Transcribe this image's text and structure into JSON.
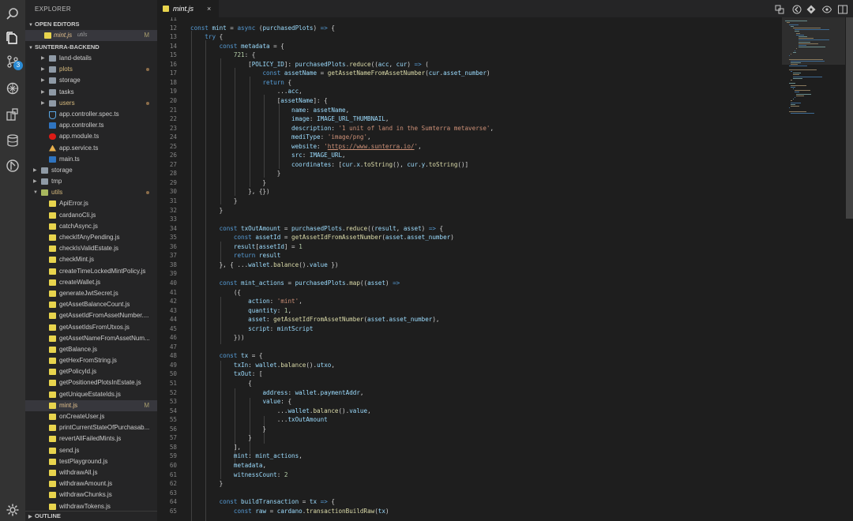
{
  "sidebar": {
    "title": "EXPLORER",
    "open_editors_header": "OPEN EDITORS",
    "open_editor": {
      "name": "mint.js",
      "dir": "utils",
      "status": "M"
    },
    "project_header": "SUNTERRA-BACKEND",
    "outline_header": "OUTLINE",
    "tree": [
      {
        "label": "land-details",
        "type": "folder",
        "depth": 2,
        "expanded": false
      },
      {
        "label": "plots",
        "type": "folder",
        "depth": 2,
        "expanded": false,
        "dot": true
      },
      {
        "label": "storage",
        "type": "folder",
        "depth": 2,
        "expanded": false
      },
      {
        "label": "tasks",
        "type": "folder",
        "depth": 2,
        "expanded": false
      },
      {
        "label": "users",
        "type": "folder",
        "depth": 2,
        "expanded": false,
        "dot": true
      },
      {
        "label": "app.controller.spec.ts",
        "type": "spec",
        "depth": 2
      },
      {
        "label": "app.controller.ts",
        "type": "ts",
        "depth": 2
      },
      {
        "label": "app.module.ts",
        "type": "module",
        "depth": 2
      },
      {
        "label": "app.service.ts",
        "type": "service",
        "depth": 2
      },
      {
        "label": "main.ts",
        "type": "ts",
        "depth": 2
      },
      {
        "label": "storage",
        "type": "folder",
        "depth": 1,
        "expanded": false
      },
      {
        "label": "tmp",
        "type": "folder",
        "depth": 1,
        "expanded": false
      },
      {
        "label": "utils",
        "type": "folder-open",
        "depth": 1,
        "expanded": true,
        "dot": true
      },
      {
        "label": "ApiError.js",
        "type": "js",
        "depth": 2
      },
      {
        "label": "cardanoCli.js",
        "type": "js",
        "depth": 2
      },
      {
        "label": "catchAsync.js",
        "type": "js",
        "depth": 2
      },
      {
        "label": "checkIfAnyPending.js",
        "type": "js",
        "depth": 2
      },
      {
        "label": "checkIsValidEstate.js",
        "type": "js",
        "depth": 2
      },
      {
        "label": "checkMint.js",
        "type": "js",
        "depth": 2
      },
      {
        "label": "createTimeLockedMintPolicy.js",
        "type": "js",
        "depth": 2
      },
      {
        "label": "createWallet.js",
        "type": "js",
        "depth": 2
      },
      {
        "label": "generateJwtSecret.js",
        "type": "js",
        "depth": 2
      },
      {
        "label": "getAssetBalanceCount.js",
        "type": "js",
        "depth": 2
      },
      {
        "label": "getAssetIdFromAssetNumber....",
        "type": "js",
        "depth": 2
      },
      {
        "label": "getAssetIdsFromUtxos.js",
        "type": "js",
        "depth": 2
      },
      {
        "label": "getAssetNameFromAssetNum...",
        "type": "js",
        "depth": 2
      },
      {
        "label": "getBalance.js",
        "type": "js",
        "depth": 2
      },
      {
        "label": "getHexFromString.js",
        "type": "js",
        "depth": 2
      },
      {
        "label": "getPolicyId.js",
        "type": "js",
        "depth": 2
      },
      {
        "label": "getPositionedPlotsInEstate.js",
        "type": "js",
        "depth": 2
      },
      {
        "label": "getUniqueEstateIds.js",
        "type": "js",
        "depth": 2
      },
      {
        "label": "mint.js",
        "type": "js",
        "depth": 2,
        "active": true,
        "status": "M"
      },
      {
        "label": "onCreateUser.js",
        "type": "js",
        "depth": 2
      },
      {
        "label": "printCurrentStateOfPurchasab...",
        "type": "js",
        "depth": 2
      },
      {
        "label": "revertAllFailedMints.js",
        "type": "js",
        "depth": 2
      },
      {
        "label": "send.js",
        "type": "js",
        "depth": 2
      },
      {
        "label": "testPlayground.js",
        "type": "js",
        "depth": 2
      },
      {
        "label": "withdrawAll.js",
        "type": "js",
        "depth": 2
      },
      {
        "label": "withdrawAmount.js",
        "type": "js",
        "depth": 2
      },
      {
        "label": "withdrawChunks.js",
        "type": "js",
        "depth": 2
      },
      {
        "label": "withdrawTokens.js",
        "type": "js",
        "depth": 2
      }
    ]
  },
  "activity": {
    "scm_badge": "3"
  },
  "tab": {
    "name": "mint.js",
    "close": "×"
  },
  "editor": {
    "lines": [
      {
        "n": "11",
        "t": ""
      },
      {
        "n": "12",
        "t": "const mint = async (purchasedPlots) => {"
      },
      {
        "n": "13",
        "t": "    try {"
      },
      {
        "n": "14",
        "t": "        const metadata = {"
      },
      {
        "n": "15",
        "t": "            721: {"
      },
      {
        "n": "16",
        "t": "                [POLICY_ID]: purchasedPlots.reduce((acc, cur) => ("
      },
      {
        "n": "17",
        "t": "                    const assetName = getAssetNameFromAssetNumber(cur.asset_number)"
      },
      {
        "n": "18",
        "t": "                    return {"
      },
      {
        "n": "19",
        "t": "                        ...acc,"
      },
      {
        "n": "20",
        "t": "                        [assetName]: {"
      },
      {
        "n": "21",
        "t": "                            name: assetName,"
      },
      {
        "n": "22",
        "t": "                            image: IMAGE_URL_THUMBNAIL,"
      },
      {
        "n": "23",
        "t": "                            description: '1 unit of land in the Sumterra metaverse',"
      },
      {
        "n": "24",
        "t": "                            mediType: 'image/png',"
      },
      {
        "n": "25",
        "t": "                            website: 'https://www.sunterra.io/',"
      },
      {
        "n": "26",
        "t": "                            src: IMAGE_URL,"
      },
      {
        "n": "27",
        "t": "                            coordinates: [cur.x.toString(), cur.y.toString()]"
      },
      {
        "n": "28",
        "t": "                        }"
      },
      {
        "n": "29",
        "t": "                    }"
      },
      {
        "n": "30",
        "t": "                }, {})"
      },
      {
        "n": "31",
        "t": "            }"
      },
      {
        "n": "32",
        "t": "        }"
      },
      {
        "n": "33",
        "t": ""
      },
      {
        "n": "34",
        "t": "        const txOutAmount = purchasedPlots.reduce((result, asset) => {"
      },
      {
        "n": "35",
        "t": "            const assetId = getAssetIdFromAssetNumber(asset.asset_number)"
      },
      {
        "n": "36",
        "t": "            result[assetId] = 1"
      },
      {
        "n": "37",
        "t": "            return result"
      },
      {
        "n": "38",
        "t": "        }, { ...wallet.balance().value })"
      },
      {
        "n": "39",
        "t": ""
      },
      {
        "n": "40",
        "t": "        const mint_actions = purchasedPlots.map((asset) =>"
      },
      {
        "n": "41",
        "t": "            ({"
      },
      {
        "n": "42",
        "t": "                action: 'mint',"
      },
      {
        "n": "43",
        "t": "                quantity: 1,"
      },
      {
        "n": "44",
        "t": "                asset: getAssetIdFromAssetNumber(asset.asset_number),"
      },
      {
        "n": "45",
        "t": "                script: mintScript"
      },
      {
        "n": "46",
        "t": "            }))"
      },
      {
        "n": "47",
        "t": ""
      },
      {
        "n": "48",
        "t": "        const tx = {"
      },
      {
        "n": "49",
        "t": "            txIn: wallet.balance().utxo,"
      },
      {
        "n": "50",
        "t": "            txOut: ["
      },
      {
        "n": "51",
        "t": "                {"
      },
      {
        "n": "52",
        "t": "                    address: wallet.paymentAddr,"
      },
      {
        "n": "53",
        "t": "                    value: {"
      },
      {
        "n": "54",
        "t": "                        ...wallet.balance().value,"
      },
      {
        "n": "55",
        "t": "                        ...txOutAmount"
      },
      {
        "n": "56",
        "t": "                    }"
      },
      {
        "n": "57",
        "t": "                }"
      },
      {
        "n": "58",
        "t": "            ],"
      },
      {
        "n": "59",
        "t": "            mint: mint_actions,"
      },
      {
        "n": "60",
        "t": "            metadata,"
      },
      {
        "n": "61",
        "t": "            witnessCount: 2"
      },
      {
        "n": "62",
        "t": "        }"
      },
      {
        "n": "63",
        "t": ""
      },
      {
        "n": "64",
        "t": "        const buildTransaction = tx => {"
      },
      {
        "n": "65",
        "t": "            const raw = cardano.transactionBuildRaw(tx)"
      }
    ]
  },
  "colors": {
    "accent": "#2a8bd5",
    "activity_bg": "#333333",
    "sidebar_bg": "#252526",
    "editor_bg": "#1e1e1e"
  }
}
